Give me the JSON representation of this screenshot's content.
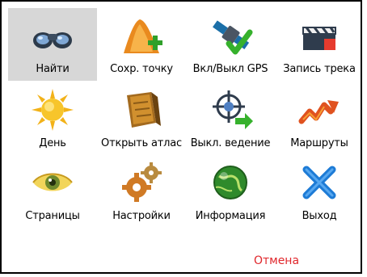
{
  "menu": {
    "items": [
      {
        "label": "Найти",
        "icon": "binoculars-icon",
        "selected": true
      },
      {
        "label": "Сохр. точку",
        "icon": "save-point-icon"
      },
      {
        "label": "Вкл/Выкл GPS",
        "icon": "satellite-icon"
      },
      {
        "label": "Запись трека",
        "icon": "track-record-icon"
      },
      {
        "label": "День",
        "icon": "sun-icon"
      },
      {
        "label": "Открыть атлас",
        "icon": "atlas-icon"
      },
      {
        "label": "Выкл. ведение",
        "icon": "navigation-off-icon"
      },
      {
        "label": "Маршруты",
        "icon": "routes-icon"
      },
      {
        "label": "Страницы",
        "icon": "eye-icon"
      },
      {
        "label": "Настройки",
        "icon": "gears-icon"
      },
      {
        "label": "Информация",
        "icon": "info-globe-icon"
      },
      {
        "label": "Выход",
        "icon": "close-x-icon"
      }
    ],
    "cancel_label": "Отмена"
  },
  "colors": {
    "selected_bg": "#d7d7d7",
    "cancel": "#e0262b"
  }
}
